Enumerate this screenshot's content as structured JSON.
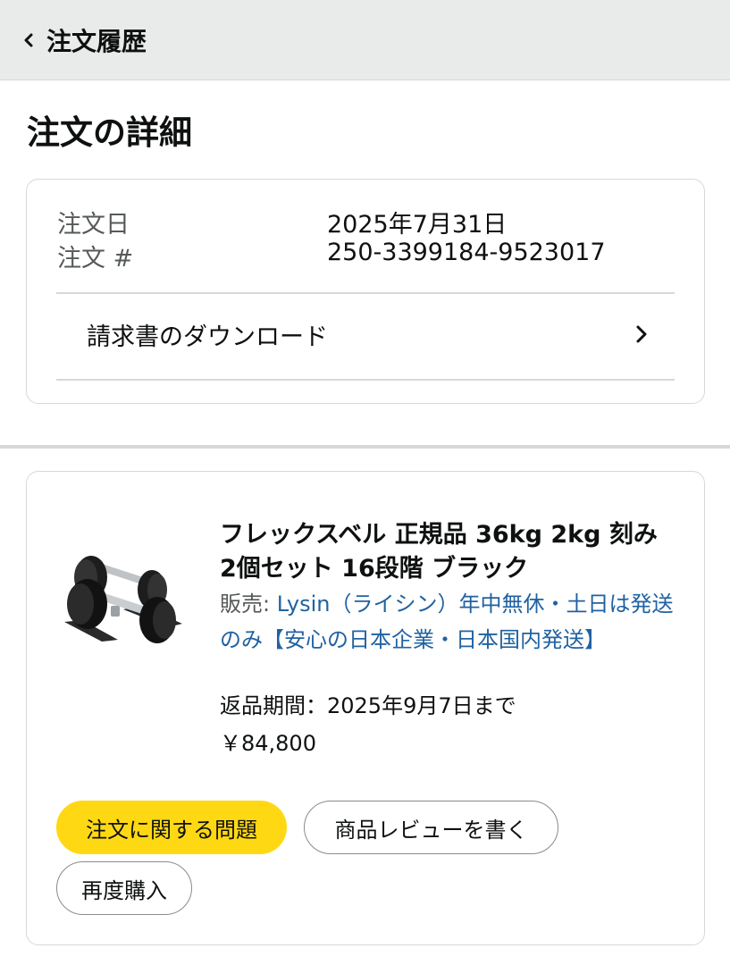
{
  "header": {
    "back_label": "注文履歴",
    "back_icon": "chevron-left-icon"
  },
  "page_title": "注文の詳細",
  "summary": {
    "order_date_label": "注文日",
    "order_date_value": "2025年7月31日",
    "order_number_label": "注文 #",
    "order_number_value": "250-3399184-9523017",
    "invoice_label": "請求書のダウンロード",
    "invoice_icon": "chevron-right-icon"
  },
  "item": {
    "title": "フレックスベル 正規品 36kg 2kg 刻み 2個セット 16段階 ブラック",
    "seller_prefix": "販売:",
    "seller_name": "Lysin（ライシン）年中無休・土日は発送のみ【安心の日本企業・日本国内発送】",
    "return_period": "返品期間：2025年9月7日まで",
    "price": "￥84,800",
    "image_icon": "adjustable-dumbbell-product-image"
  },
  "actions": {
    "problem_label": "注文に関する問題",
    "review_label": "商品レビューを書く",
    "rebuy_label": "再度購入"
  },
  "colors": {
    "accent_yellow": "#ffd814",
    "link_blue": "#2162a1",
    "header_bg": "#e9eaea"
  }
}
